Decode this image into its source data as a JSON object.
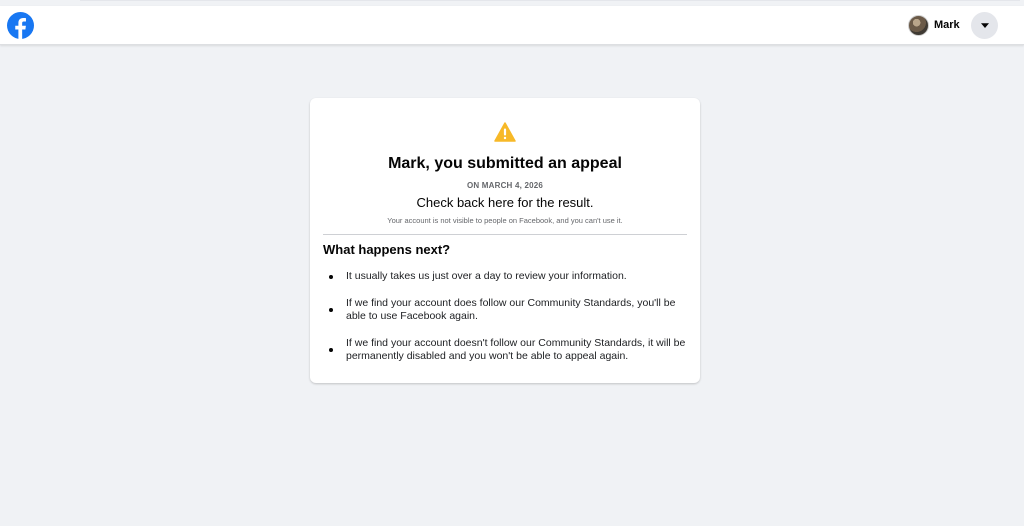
{
  "navbar": {
    "logo_icon": "facebook-logo-icon",
    "brand_color": "#1877f2",
    "profile_name": "Mark",
    "menu_icon": "caret-down-icon"
  },
  "card": {
    "warning_icon": "warning-triangle-icon",
    "warning_color": "#f7b928",
    "title": "Mark, you submitted an appeal",
    "date": "ON MARCH 4, 2026",
    "check_back": "Check back here for the result.",
    "note": "Your account is not visible to people on Facebook, and you can't use it.",
    "next_heading": "What happens next?",
    "bullets": [
      "It usually takes us just over a day to review your information.",
      "If we find your account does follow our Community Standards, you'll be able to use Facebook again.",
      "If we find your account doesn't follow our Community Standards, it will be permanently disabled and you won't be able to appeal again."
    ]
  }
}
